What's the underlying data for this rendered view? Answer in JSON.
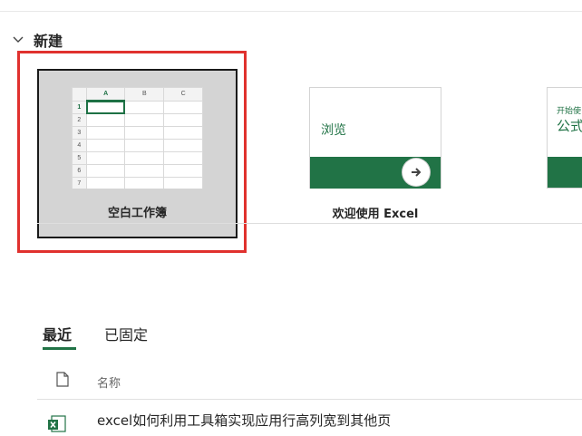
{
  "new_section": {
    "title": "新建",
    "icon": "chevron-down-icon"
  },
  "templates": [
    {
      "label": "空白工作簿"
    },
    {
      "label": "欢迎使用 Excel",
      "thumb_text": "浏览"
    },
    {
      "thumb_small": "开始使",
      "thumb_big": "公式"
    }
  ],
  "sheet_preview": {
    "columns": [
      "A",
      "B",
      "C"
    ],
    "rows": [
      "1",
      "2",
      "3",
      "4",
      "5",
      "6",
      "7"
    ]
  },
  "tabs": [
    {
      "label": "最近",
      "active": true
    },
    {
      "label": "已固定",
      "active": false
    }
  ],
  "list": {
    "header_name": "名称",
    "header_icon": "document-icon",
    "items": [
      {
        "name": "excel如何利用工具箱实现应用行高列宽到其他页",
        "icon": "excel-file-icon"
      }
    ]
  },
  "colors": {
    "accent": "#217346",
    "highlight": "#e0312e",
    "blank_tile_bg": "#d4d4d4"
  }
}
